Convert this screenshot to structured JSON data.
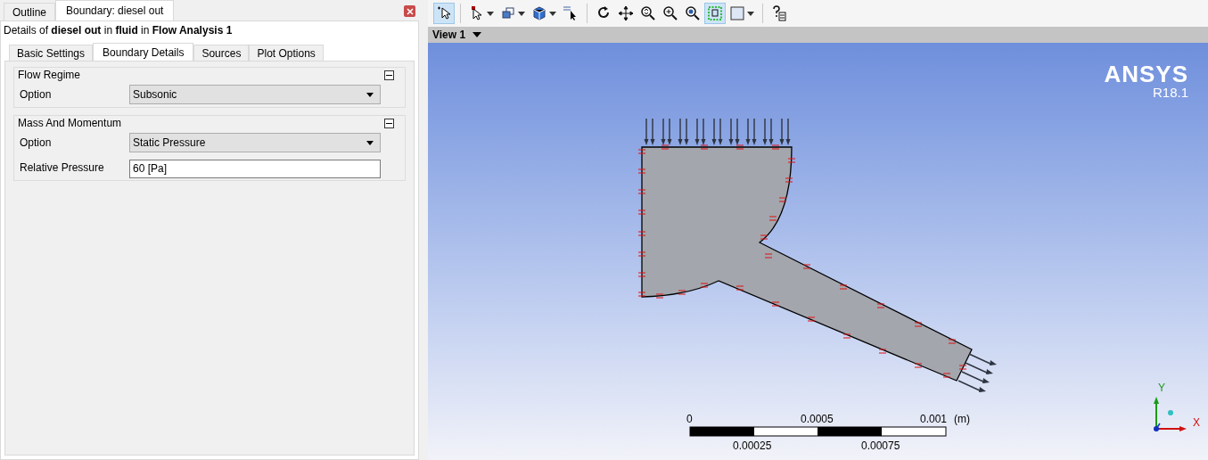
{
  "panel_tabs": [
    {
      "label": "Outline",
      "selected": false
    },
    {
      "label": "Boundary: diesel out",
      "selected": true
    }
  ],
  "details_title": "Details of **diesel out** in **fluid** in **Flow Analysis 1**",
  "detail_tabs": [
    {
      "label": "Basic Settings",
      "selected": false
    },
    {
      "label": "Boundary Details",
      "selected": true
    },
    {
      "label": "Sources",
      "selected": false
    },
    {
      "label": "Plot Options",
      "selected": false
    }
  ],
  "groups": [
    {
      "title": "Flow Regime",
      "expanded": true,
      "rows": [
        {
          "kind": "dropdown",
          "label": "Option",
          "value": "Subsonic"
        }
      ]
    },
    {
      "title": "Mass And Momentum",
      "expanded": true,
      "rows": [
        {
          "kind": "dropdown",
          "label": "Option",
          "value": "Static Pressure"
        },
        {
          "kind": "text",
          "label": "Relative Pressure",
          "value": "60 [Pa]"
        }
      ]
    }
  ],
  "toolbar": [
    {
      "kind": "select",
      "active": true
    },
    {
      "kind": "sep"
    },
    {
      "kind": "pick",
      "active": false
    },
    {
      "kind": "boxes",
      "active": false
    },
    {
      "kind": "cube",
      "active": false
    },
    {
      "kind": "probe",
      "active": false
    },
    {
      "kind": "sep"
    },
    {
      "kind": "rotate",
      "active": false
    },
    {
      "kind": "pan",
      "active": false
    },
    {
      "kind": "zoom",
      "active": false
    },
    {
      "kind": "zoomin",
      "active": false
    },
    {
      "kind": "zoombox",
      "active": false
    },
    {
      "kind": "fit",
      "active": true
    },
    {
      "kind": "square",
      "active": false
    },
    {
      "kind": "sep"
    },
    {
      "kind": "help",
      "active": false
    }
  ],
  "view": {
    "title": "View 1",
    "logo": "ANSYS",
    "version": "R18.1",
    "scale": {
      "top_labels": [
        "0",
        "0.0005",
        "0.001"
      ],
      "unit": "(m)",
      "bottom_labels": [
        "0.00025",
        "0.00075"
      ]
    },
    "axes": {
      "y": "Y",
      "x": "X"
    }
  }
}
